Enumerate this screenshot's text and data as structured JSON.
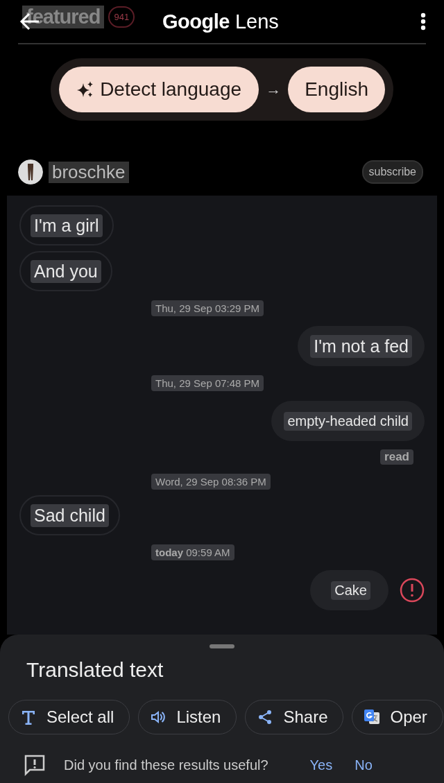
{
  "header": {
    "overlay_tab": "featured",
    "overlay_count": "941",
    "title_brand": "Google",
    "title_product": "Lens"
  },
  "language_bar": {
    "source": "Detect language",
    "arrow": "→",
    "target": "English"
  },
  "chat_header": {
    "username": "broschke",
    "subscribe": "subscribe"
  },
  "messages": [
    {
      "kind": "incoming",
      "text": "I'm a girl"
    },
    {
      "kind": "incoming",
      "text": "And you"
    },
    {
      "kind": "timestamp",
      "text": "Thu, 29 Sep 03:29 PM"
    },
    {
      "kind": "outgoing",
      "text": "I'm not a fed",
      "failed": false
    },
    {
      "kind": "timestamp",
      "text": "Thu, 29 Sep 07:48 PM"
    },
    {
      "kind": "outgoing",
      "text": "empty-headed child",
      "failed": false
    },
    {
      "kind": "status",
      "text": "read"
    },
    {
      "kind": "timestamp",
      "text": "Word, 29 Sep 08:36 PM"
    },
    {
      "kind": "incoming",
      "text": "Sad child"
    },
    {
      "kind": "timestamp",
      "text": "**today** 09:59 AM"
    },
    {
      "kind": "outgoing",
      "text": "Cake",
      "failed": true
    }
  ],
  "sheet": {
    "title": "Translated text",
    "actions": [
      {
        "kind": "select",
        "label": "Select all"
      },
      {
        "kind": "listen",
        "label": "Listen"
      },
      {
        "kind": "share",
        "label": "Share"
      },
      {
        "kind": "translate",
        "label": "Oper"
      }
    ],
    "feedback": {
      "question": "Did you find these results useful?",
      "yes": "Yes",
      "no": "No"
    }
  }
}
